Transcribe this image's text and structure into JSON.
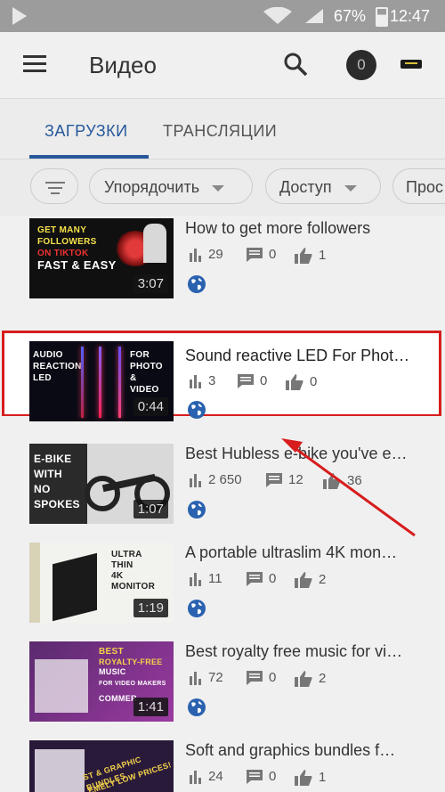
{
  "status": {
    "battery": "67%",
    "time": "12:47"
  },
  "appbar": {
    "title": "Видео",
    "avatar_text": "0"
  },
  "tabs": [
    {
      "label": "ЗАГРУЗКИ"
    },
    {
      "label": "ТРАНСЛЯЦИИ"
    }
  ],
  "filters": {
    "sort_label": "Упорядочить",
    "access_label": "Доступ",
    "more_label": "Прос"
  },
  "videos": [
    {
      "title": "How to get more followers",
      "views": "29",
      "comments": "0",
      "likes": "1",
      "duration": "3:07",
      "thumb_text": [
        "GET MANY",
        "FOLLOWERS",
        "ON TIKTOK",
        "FAST & EASY"
      ]
    },
    {
      "title": "Sound reactive LED For Phot…",
      "views": "3",
      "comments": "0",
      "likes": "0",
      "duration": "0:44",
      "thumb_text": [
        "AUDIO",
        "REACTION",
        "LED",
        "FOR",
        "PHOTO",
        "&",
        "VIDEO"
      ]
    },
    {
      "title": "Best Hubless e-bike you've e…",
      "views": "2 650",
      "comments": "12",
      "likes": "36",
      "duration": "1:07",
      "thumb_text": [
        "E-BIKE",
        "WITH",
        "NO",
        "SPOKES"
      ]
    },
    {
      "title": "A portable ultraslim 4K mon…",
      "views": "11",
      "comments": "0",
      "likes": "2",
      "duration": "1:19",
      "thumb_text": [
        "ULTRA",
        "THIN",
        "4K",
        "MONITOR"
      ]
    },
    {
      "title": "Best royalty free music for vi…",
      "views": "72",
      "comments": "0",
      "likes": "2",
      "duration": "1:41",
      "thumb_text": [
        "BEST",
        "ROYALTY-FREE",
        "MUSIC",
        "FOR VIDEO MAKERS",
        "COMMER"
      ]
    },
    {
      "title": "Soft and graphics bundles f…",
      "views": "24",
      "comments": "0",
      "likes": "1",
      "duration": "",
      "thumb_text": [
        "ST & GRAPHIC BUNDLES",
        "EMELY LOW PRICES!"
      ]
    }
  ],
  "colors": {
    "accent": "#25579a",
    "highlight": "#d71d1d",
    "globe": "#2a62b0"
  }
}
